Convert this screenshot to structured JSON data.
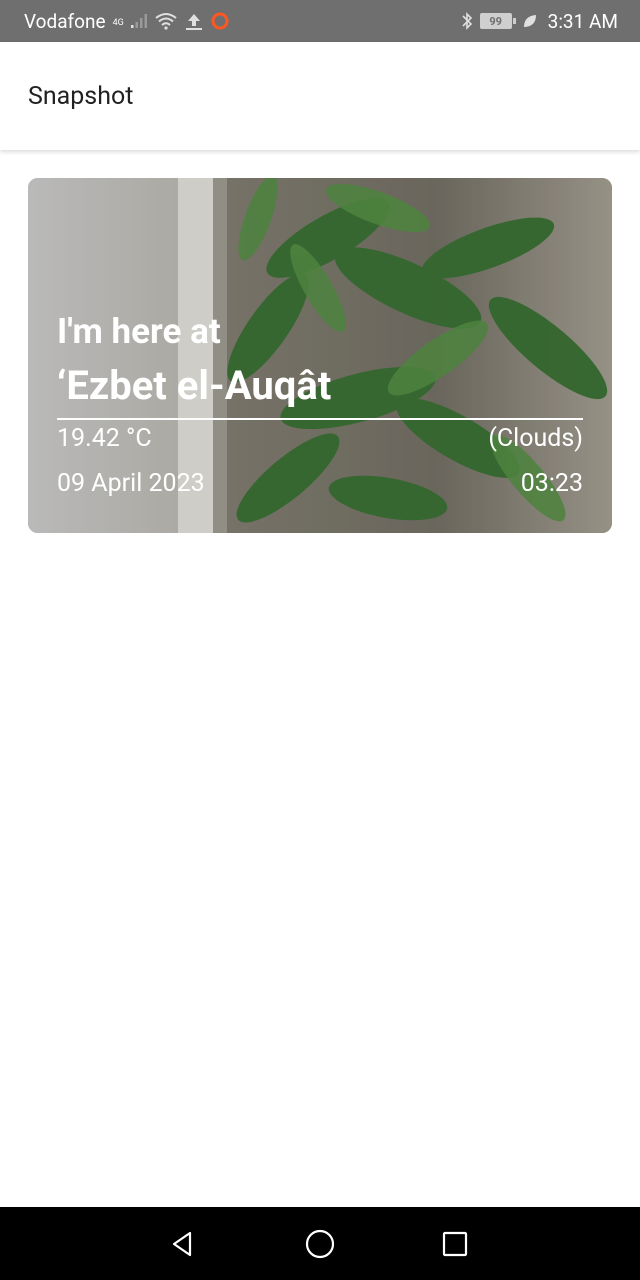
{
  "status_bar": {
    "carrier": "Vodafone",
    "network": "4G",
    "battery": "99",
    "time": "3:31 AM"
  },
  "app_bar": {
    "title": "Snapshot"
  },
  "snapshot_card": {
    "intro": "I'm here at",
    "location": "‘Ezbet el-Auqât",
    "temperature": "19.42 °C",
    "condition": "(Clouds)",
    "date": "09 April 2023",
    "time": "03:23"
  },
  "colors": {
    "status_bar_bg": "#6f6f6f",
    "app_bar_bg": "#ffffff",
    "nav_bar_bg": "#000000",
    "card_text": "#ffffff"
  },
  "icons": {
    "status_bar": [
      "signal-icon",
      "wifi-icon",
      "upload-icon",
      "record-icon",
      "bluetooth-icon",
      "battery-icon",
      "leaf-icon"
    ],
    "nav_bar": [
      "back-icon",
      "home-icon",
      "recents-icon"
    ]
  }
}
